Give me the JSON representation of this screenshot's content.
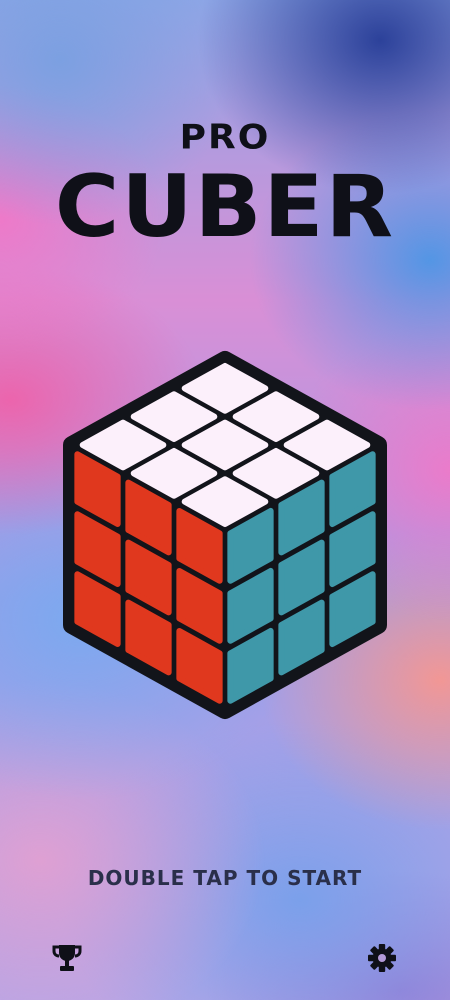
{
  "title": {
    "pro": "PRO",
    "main": "CUBER"
  },
  "cube": {
    "top_color": "#fcf0fb",
    "left_color": "#e0381e",
    "right_color": "#3f98a9",
    "frame_color": "#12141a"
  },
  "hint": "DOUBLE TAP TO START",
  "footer": {
    "left_icon": "trophy-icon",
    "right_icon": "gear-icon"
  }
}
